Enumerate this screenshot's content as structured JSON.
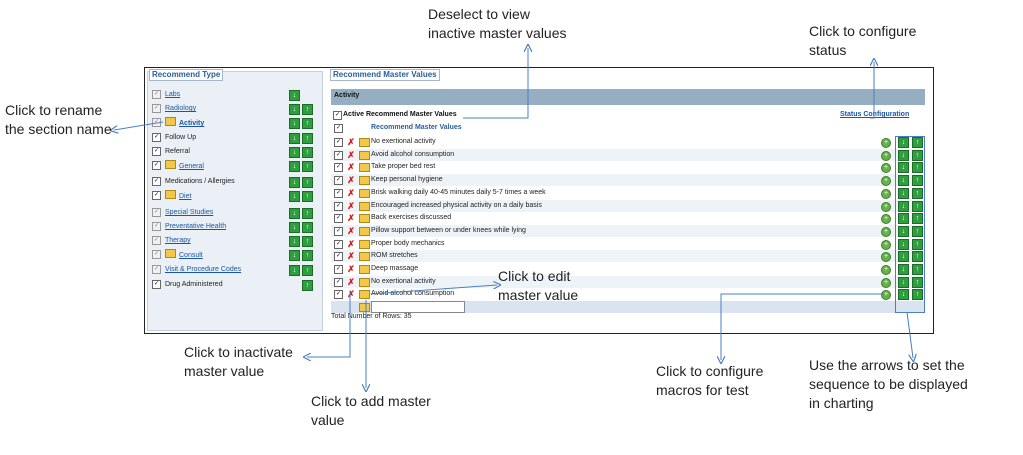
{
  "recommend_type": {
    "legend": "Recommend Type",
    "items": [
      {
        "label": "Labs",
        "style": "link",
        "checked": true,
        "disabled": true,
        "folder": false,
        "arrows": [
          "down"
        ]
      },
      {
        "label": "Radiology",
        "style": "link",
        "checked": true,
        "disabled": true,
        "folder": false,
        "arrows": [
          "down",
          "up"
        ]
      },
      {
        "label": "Activity",
        "style": "link-bold",
        "checked": true,
        "disabled": true,
        "folder": true,
        "arrows": [
          "down",
          "up"
        ]
      },
      {
        "label": "Follow Up",
        "style": "plain",
        "checked": true,
        "disabled": false,
        "folder": false,
        "arrows": [
          "down",
          "up"
        ]
      },
      {
        "label": "Referral",
        "style": "plain",
        "checked": true,
        "disabled": false,
        "folder": false,
        "arrows": [
          "down",
          "up"
        ]
      },
      {
        "label": "General",
        "style": "link",
        "checked": true,
        "disabled": false,
        "folder": true,
        "arrows": [
          "down",
          "up"
        ]
      },
      {
        "label": "Medications / Allergies",
        "style": "plain",
        "checked": true,
        "disabled": false,
        "folder": false,
        "arrows": [
          "down",
          "up"
        ]
      },
      {
        "label": "Diet",
        "style": "link",
        "checked": true,
        "disabled": false,
        "folder": true,
        "arrows": [
          "down",
          "up"
        ]
      },
      {
        "label": "Special Studies",
        "style": "link",
        "checked": true,
        "disabled": true,
        "folder": false,
        "arrows": [
          "down",
          "up"
        ]
      },
      {
        "label": "Preventative Health",
        "style": "link",
        "checked": true,
        "disabled": true,
        "folder": false,
        "arrows": [
          "down",
          "up"
        ]
      },
      {
        "label": "Therapy",
        "style": "link",
        "checked": true,
        "disabled": true,
        "folder": false,
        "arrows": [
          "down",
          "up"
        ]
      },
      {
        "label": "Consult",
        "style": "link",
        "checked": true,
        "disabled": true,
        "folder": true,
        "arrows": [
          "down",
          "up"
        ]
      },
      {
        "label": "Visit & Procedure Codes",
        "style": "link",
        "checked": true,
        "disabled": true,
        "folder": false,
        "arrows": [
          "down",
          "up"
        ]
      },
      {
        "label": "Drug Administered",
        "style": "plain",
        "checked": true,
        "disabled": false,
        "folder": false,
        "arrows": [
          "up"
        ]
      }
    ]
  },
  "master_values": {
    "legend": "Recommend Master Values",
    "section_title": "Activity",
    "active_label": "Active Recommend Master Values",
    "active_checked": true,
    "status_link": "Status Configuration",
    "column_header": "Recommend Master Values",
    "rows": [
      "No exertional activity",
      "Avoid alcohol consumption",
      "Take proper bed rest",
      "Keep personal hygiene",
      "Brisk walking daily 40-45 minutes daily 5-7 times a week",
      "Encouraged increased physical activity on a daily basis",
      "Back exercises discussed",
      "Pillow support between or under knees while lying",
      "Proper body mechanics",
      "ROM stretches",
      "Deep massage",
      "No exertional activity",
      "Avoid alcohol consumption"
    ],
    "new_value": "",
    "total_rows": "Total Number of Rows: 35"
  },
  "icons": {
    "checkbox": "checkbox-icon",
    "inactivate": "red-x-icon",
    "edit": "folder-edit-icon",
    "macro": "green-plus-icon",
    "move_down": "green-down-arrow-icon",
    "move_up": "green-up-arrow-icon"
  },
  "colors": {
    "band": "#96aec2",
    "link": "#1a56a8",
    "arrow_green": "#2f9e3f",
    "inactivate_red": "#d51d1d",
    "callout_line": "#4a7fc0",
    "left_panel_bg": "#eaf0f6"
  },
  "annotations": {
    "deselect": "Deselect to view\ninactive master values",
    "status": "Click to configure\nstatus",
    "rename": "Click to rename\nthe section name",
    "edit": "Click to edit\nmaster value",
    "inactivate": "Click to inactivate\nmaster value",
    "add": "Click to add master\nvalue",
    "macros": "Click to configure\nmacros for test",
    "arrows": "Use the arrows to set the\nsequence to be displayed\nin charting"
  }
}
